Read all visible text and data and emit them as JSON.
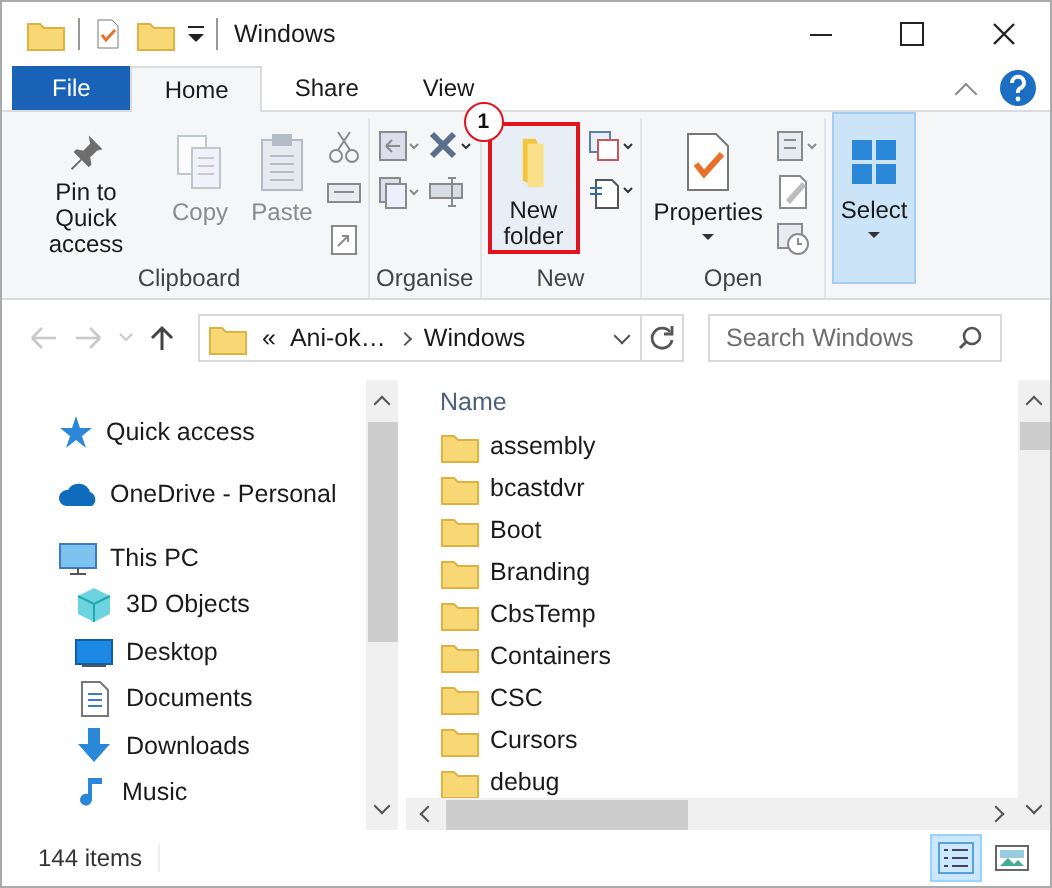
{
  "window": {
    "title": "Windows"
  },
  "tabs": [
    {
      "label": "File",
      "kind": "file",
      "selected": false
    },
    {
      "label": "Home",
      "kind": "tab",
      "selected": true
    },
    {
      "label": "Share",
      "kind": "tab",
      "selected": false
    },
    {
      "label": "View",
      "kind": "tab",
      "selected": false
    }
  ],
  "ribbon": {
    "groups": [
      {
        "label": "Clipboard",
        "buttons": [
          {
            "kind": "pin",
            "label": "Pin to Quick access",
            "disabled": false,
            "highlighted": false,
            "pressed": false,
            "caret": false
          },
          {
            "kind": "copy",
            "label": "Copy",
            "disabled": true,
            "highlighted": false,
            "pressed": false,
            "caret": false
          },
          {
            "kind": "paste",
            "label": "Paste",
            "disabled": true,
            "highlighted": false,
            "pressed": false,
            "caret": false
          }
        ]
      },
      {
        "label": "Organise"
      },
      {
        "label": "New",
        "buttons": [
          {
            "kind": "new-folder",
            "label": "New folder",
            "disabled": false,
            "highlighted": true,
            "pressed": false,
            "caret": false,
            "badge": "1"
          }
        ]
      },
      {
        "label": "Open",
        "buttons": [
          {
            "kind": "properties",
            "label": "Properties",
            "disabled": false,
            "highlighted": false,
            "pressed": false,
            "caret": true
          }
        ]
      },
      {
        "buttons": [
          {
            "kind": "select",
            "label": "Select",
            "disabled": false,
            "highlighted": false,
            "pressed": true,
            "caret": true
          }
        ]
      }
    ]
  },
  "address": {
    "segments": [
      "«",
      "Ani-ok…",
      "Windows"
    ],
    "search_placeholder": "Search Windows"
  },
  "navigation": [
    {
      "label": "Quick access",
      "kind": "quick"
    },
    {
      "label": "OneDrive - Personal",
      "kind": "cloud"
    },
    {
      "label": "This PC",
      "kind": "pc",
      "children": [
        {
          "label": "3D Objects",
          "kind": "cube"
        },
        {
          "label": "Desktop",
          "kind": "desktop"
        },
        {
          "label": "Documents",
          "kind": "documents"
        },
        {
          "label": "Downloads",
          "kind": "downloads"
        },
        {
          "label": "Music",
          "kind": "music"
        }
      ]
    }
  ],
  "files": {
    "columns": [
      "Name"
    ],
    "rows": [
      "assembly",
      "bcastdvr",
      "Boot",
      "Branding",
      "CbsTemp",
      "Containers",
      "CSC",
      "Cursors",
      "debug"
    ]
  },
  "status_bar": {
    "count": "144 items",
    "views": [
      {
        "kind": "details",
        "selected": true
      },
      {
        "kind": "large",
        "selected": false
      }
    ]
  }
}
